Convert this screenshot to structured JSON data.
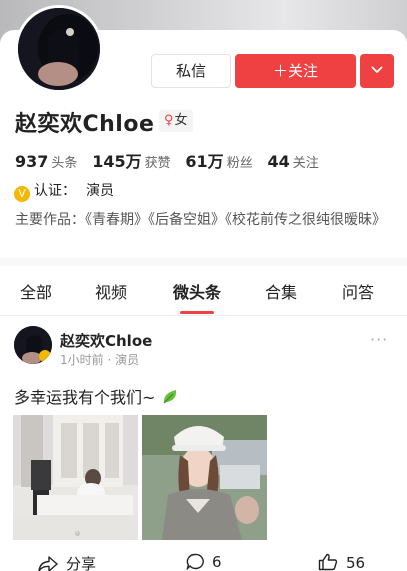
{
  "profile": {
    "name": "赵奕欢Chloe",
    "gender_symbol": "♀",
    "gender": "女",
    "stats": [
      {
        "value": "937",
        "label": "头条"
      },
      {
        "value": "145万",
        "label": "获赞"
      },
      {
        "value": "61万",
        "label": "粉丝"
      },
      {
        "value": "44",
        "label": "关注"
      }
    ],
    "verify_badge": "V",
    "verify_label": "认证：",
    "verify_value": "演员",
    "works": "主要作品：《青春期》《后备空姐》《校花前传之很纯很暧昧》"
  },
  "buttons": {
    "message": "私信",
    "follow": "＋关注",
    "more_icon": "chevron-down-icon"
  },
  "tabs": [
    "全部",
    "视频",
    "微头条",
    "合集",
    "问答"
  ],
  "active_tab": "微头条",
  "post": {
    "author": "赵奕欢Chloe",
    "meta": "1小时前 · 演员",
    "more": "···",
    "text": "多幸运我有个我们~",
    "actions": {
      "share": "分享",
      "comments": "6",
      "likes": "56"
    }
  },
  "colors": {
    "accent": "#f04142",
    "verify": "#f5b800"
  }
}
